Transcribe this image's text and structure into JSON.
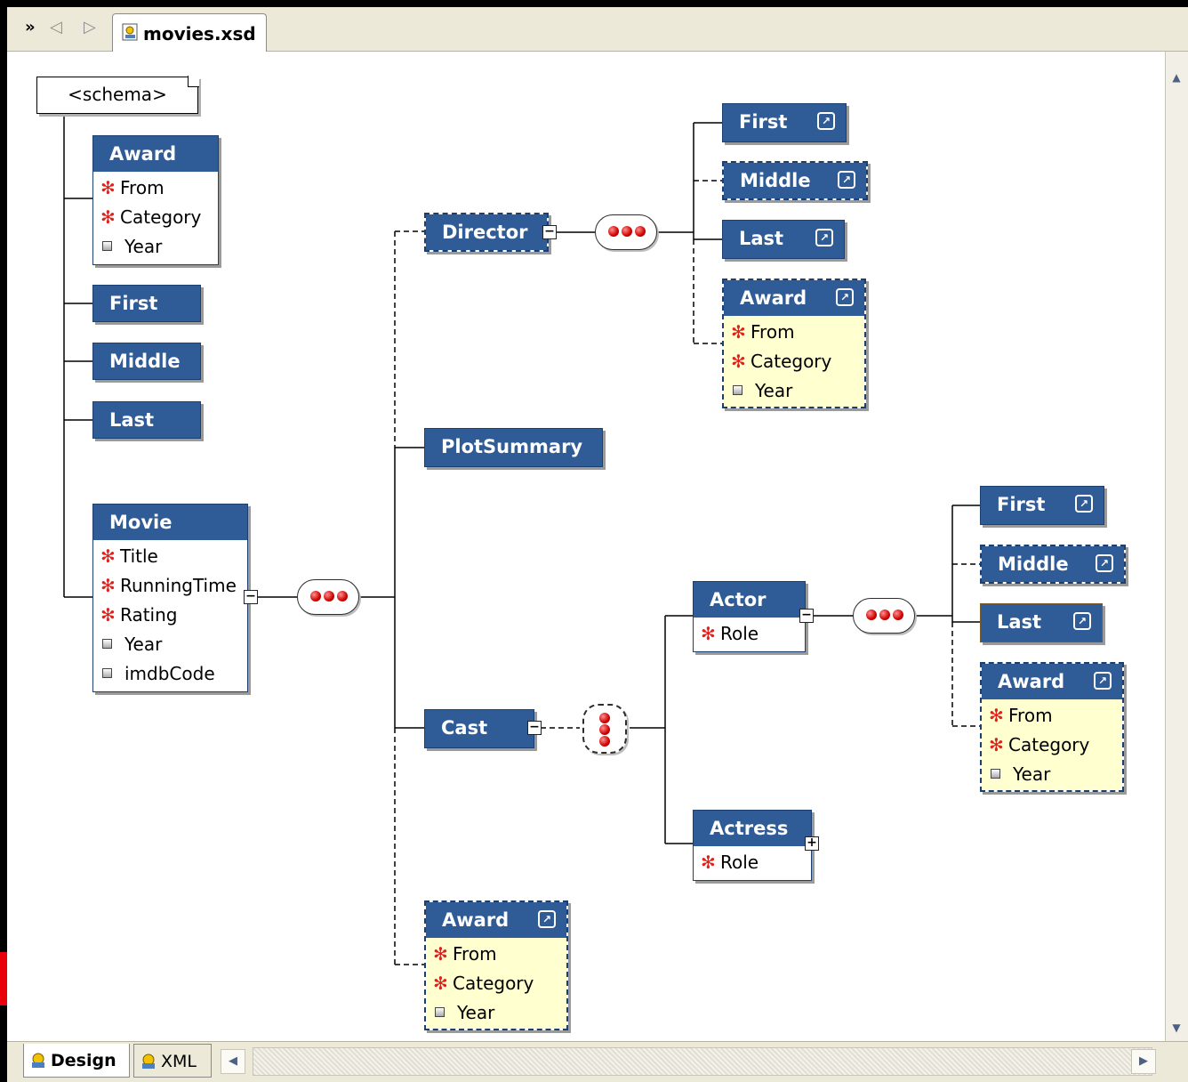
{
  "editor": {
    "nav_menu": "»",
    "nav_back": "◁",
    "nav_forward": "▷",
    "file_tab": "movies.xsd"
  },
  "schema_root": "<schema>",
  "global_elements": {
    "award": {
      "name": "Award",
      "attrs": [
        {
          "name": "From",
          "required": true
        },
        {
          "name": "Category",
          "required": true
        },
        {
          "name": "Year",
          "required": false
        }
      ]
    },
    "first": {
      "name": "First"
    },
    "middle": {
      "name": "Middle"
    },
    "last": {
      "name": "Last"
    },
    "movie": {
      "name": "Movie",
      "attrs": [
        {
          "name": "Title",
          "required": true
        },
        {
          "name": "RunningTime",
          "required": true
        },
        {
          "name": "Rating",
          "required": true
        },
        {
          "name": "Year",
          "required": false
        },
        {
          "name": "imdbCode",
          "required": false
        }
      ]
    }
  },
  "movie_children": {
    "director": {
      "name": "Director"
    },
    "plot_summary": {
      "name": "PlotSummary"
    },
    "cast": {
      "name": "Cast"
    },
    "award_ref": {
      "name": "Award",
      "attrs": [
        {
          "name": "From",
          "required": true
        },
        {
          "name": "Category",
          "required": true
        },
        {
          "name": "Year",
          "required": false
        }
      ]
    }
  },
  "director_children": {
    "first_ref": {
      "name": "First"
    },
    "middle_ref": {
      "name": "Middle"
    },
    "last_ref": {
      "name": "Last"
    },
    "award_ref": {
      "name": "Award",
      "attrs": [
        {
          "name": "From",
          "required": true
        },
        {
          "name": "Category",
          "required": true
        },
        {
          "name": "Year",
          "required": false
        }
      ]
    }
  },
  "cast_children": {
    "actor": {
      "name": "Actor",
      "attrs": [
        {
          "name": "Role",
          "required": true
        }
      ]
    },
    "actress": {
      "name": "Actress",
      "attrs": [
        {
          "name": "Role",
          "required": true
        }
      ]
    }
  },
  "actor_children": {
    "first_ref": {
      "name": "First"
    },
    "middle_ref": {
      "name": "Middle"
    },
    "last_ref": {
      "name": "Last"
    },
    "award_ref": {
      "name": "Award",
      "attrs": [
        {
          "name": "From",
          "required": true
        },
        {
          "name": "Category",
          "required": true
        },
        {
          "name": "Year",
          "required": false
        }
      ]
    }
  },
  "bottom_tabs": {
    "design": "Design",
    "xml": "XML"
  },
  "icons": {
    "required_marker": "✻",
    "collapse": "−",
    "expand": "+",
    "ref_icon": "↗",
    "scroll_up": "▲",
    "scroll_down": "▼",
    "scroll_left": "◀",
    "scroll_right": "▶"
  },
  "colors": {
    "element_header": "#2f5b96",
    "reference_body": "#ffffcf",
    "required_marker": "#e0201b"
  }
}
